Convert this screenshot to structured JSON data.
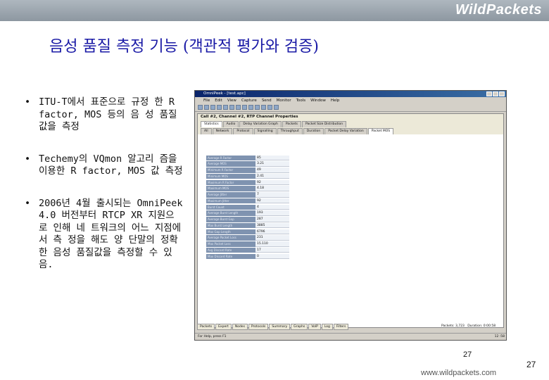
{
  "brand": "WildPackets",
  "title": "음성 품질 측정 기능 (객관적 평가와 검증)",
  "bullets": [
    {
      "marker": "•",
      "text": "ITU-T에서 표준으로 규정 한 R factor, MOS 등의 음 성 품질 값을 측정"
    },
    {
      "marker": "•",
      "text": "Techemy의 VQmon 알고리 즘을 이용한 R factor, MOS 값 측정"
    },
    {
      "marker": "•",
      "text": "2006년 4월 출시되는 OmniPeek 4.0 버전부터 RTCP XR 지원으로 인해 네 트워크의 어느 지점에서 측 정을 해도 양 단말의 정확한 음성 품질값을 측정할 수 있 음."
    }
  ],
  "screenshot": {
    "window_title": "OmniPeek - [test.apc]",
    "menu": [
      "File",
      "Edit",
      "View",
      "Capture",
      "Send",
      "Monitor",
      "Tools",
      "Window",
      "Help"
    ],
    "call_header": "Call #2, Channel #2, RTP Channel Properties",
    "tabs_row1": [
      "Statistics",
      "Audio",
      "Delay Variation Graph",
      "Packets",
      "Packet Size Distribution"
    ],
    "tabs_row2": [
      "All",
      "Network",
      "Protocol",
      "Signalling",
      "Throughput",
      "Duration",
      "Packet Delay Variation",
      "Packet MOS"
    ],
    "active_tab": "Packet MOS",
    "grid_rows": [
      {
        "label": "Average R Factor",
        "value": "85"
      },
      {
        "label": "Average MOS",
        "value": "3.21"
      },
      {
        "label": "Minimum R Factor",
        "value": "49"
      },
      {
        "label": "Minimum MOS",
        "value": "2.41"
      },
      {
        "label": "Maximum R Factor",
        "value": "92"
      },
      {
        "label": "Maximum MOS",
        "value": "4.18"
      },
      {
        "label": "Average Jitter",
        "value": "7"
      },
      {
        "label": "Maximum Jitter",
        "value": "92"
      },
      {
        "label": "Burst Count",
        "value": "4"
      },
      {
        "label": "Average Burst Length",
        "value": "193"
      },
      {
        "label": "Average Burst Gap",
        "value": "287"
      },
      {
        "label": "Max Burst Length",
        "value": "3885"
      },
      {
        "label": "Max Gap Length",
        "value": "6796"
      },
      {
        "label": "Average Packet Loss",
        "value": "231"
      },
      {
        "label": "Max Packet Loss",
        "value": "15.110"
      },
      {
        "label": "Avg Discard Rate",
        "value": "17"
      },
      {
        "label": "Max Discard Rate",
        "value": "0"
      }
    ],
    "bottom_tabs": [
      "Packets",
      "Expert",
      "Nodes",
      "Protocols",
      "Summary",
      "Graphs",
      "VoIP",
      "Log",
      "Filters"
    ],
    "packets_label": "Packets:",
    "packets_value": "3,723",
    "duration_label": "Duration:",
    "duration_value": "0:00:58",
    "status_text": "For Help, press F1",
    "status_right": "12 :58"
  },
  "page_number": "27",
  "url": "www.wildpackets.com",
  "page_number_corner": "27"
}
